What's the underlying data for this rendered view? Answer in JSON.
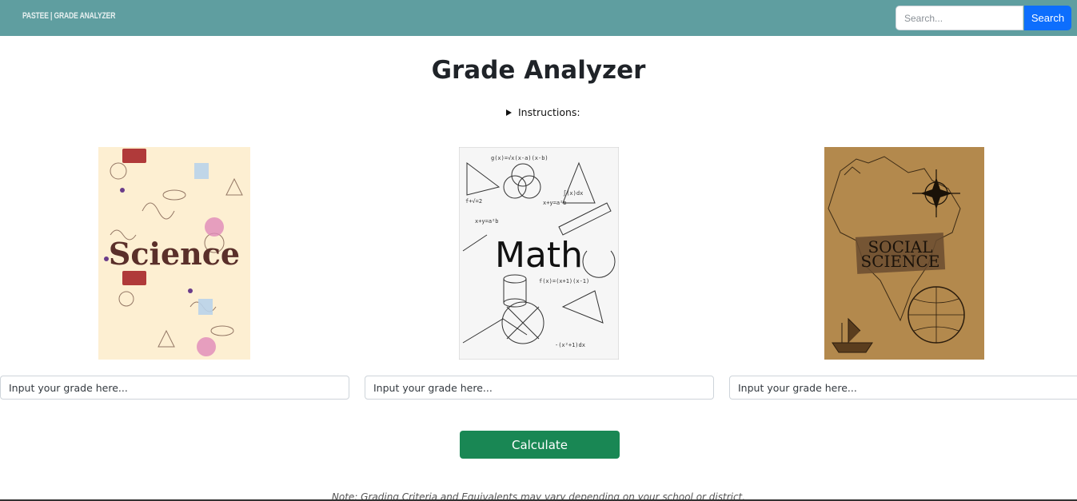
{
  "navbar": {
    "brand": "PASTEE | GRADE ANALYZER",
    "search_placeholder": "Search...",
    "search_button": "Search",
    "color": "#5f9ea0"
  },
  "main": {
    "title": "Grade Analyzer",
    "instructions_label": "Instructions:"
  },
  "subjects": [
    {
      "cover_text": "Science",
      "input_placeholder": "Input your grade here..."
    },
    {
      "cover_text": "Math",
      "input_placeholder": "Input your grade here..."
    },
    {
      "cover_text_line1": "SOCIAL",
      "cover_text_line2": "SCIENCE",
      "input_placeholder": "Input your grade here..."
    }
  ],
  "calculate_button": "Calculate",
  "note": "Note: Grading Criteria and Equivalents may vary depending on your school or district.",
  "colors": {
    "calculate": "#198754",
    "search": "#0d6efd"
  }
}
